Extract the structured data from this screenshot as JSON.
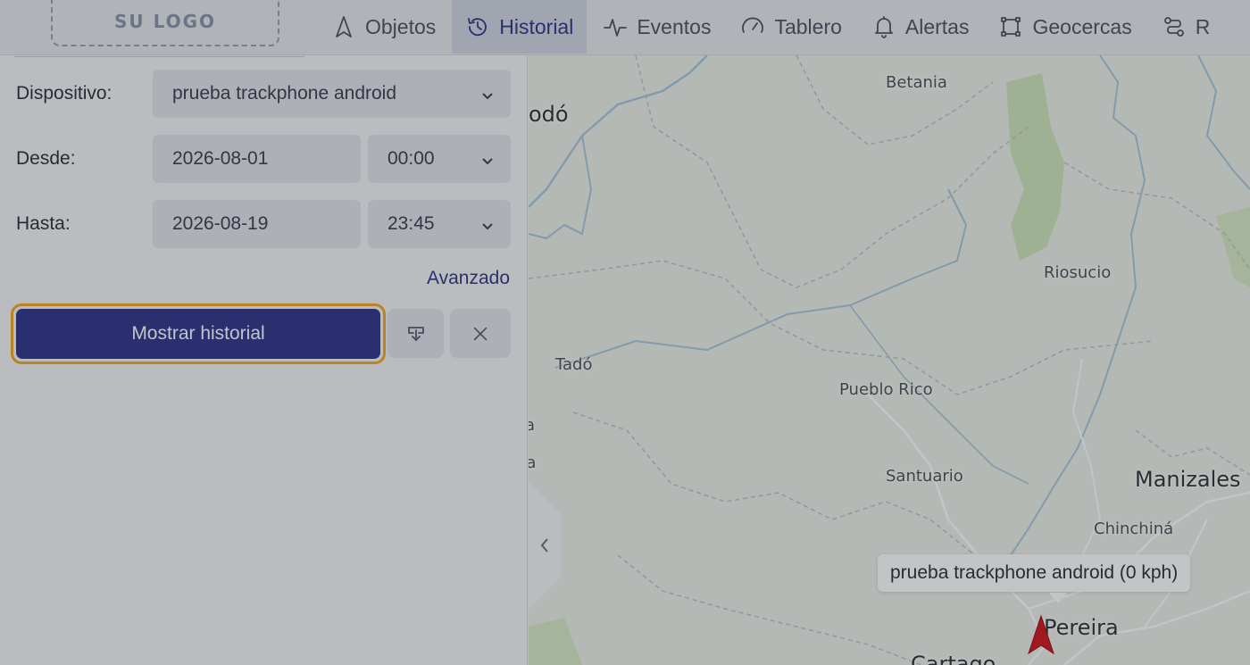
{
  "header": {
    "logo_text": "SU LOGO",
    "tabs": [
      {
        "label": "Objetos",
        "icon": "navigation-arrow-icon"
      },
      {
        "label": "Historial",
        "icon": "history-icon",
        "active": true
      },
      {
        "label": "Eventos",
        "icon": "activity-icon"
      },
      {
        "label": "Tablero",
        "icon": "gauge-icon"
      },
      {
        "label": "Alertas",
        "icon": "bell-icon"
      },
      {
        "label": "Geocercas",
        "icon": "geofence-icon"
      },
      {
        "label": "R",
        "icon": "route-icon"
      }
    ]
  },
  "history_form": {
    "device_label": "Dispositivo:",
    "device_value": "prueba trackphone android",
    "from_label": "Desde:",
    "from_date": "2026-08-01",
    "from_time": "00:00",
    "to_label": "Hasta:",
    "to_date": "2026-08-19",
    "to_time": "23:45",
    "advanced_link": "Avanzado",
    "show_button": "Mostrar historial",
    "download_icon": "download-icon",
    "clear_icon": "close-icon"
  },
  "map": {
    "places": [
      {
        "name": "Betania",
        "size": "sm"
      },
      {
        "name": "odó",
        "size": "lg"
      },
      {
        "name": "Riosucio",
        "size": "sm"
      },
      {
        "name": "Tadó",
        "size": "sm"
      },
      {
        "name": "Pueblo Rico",
        "size": "sm"
      },
      {
        "name": "Santuario",
        "size": "sm"
      },
      {
        "name": "Manizales",
        "size": "lg"
      },
      {
        "name": "Chinchiná",
        "size": "sm"
      },
      {
        "name": "Pereira",
        "size": "lg"
      },
      {
        "name": "Cartago",
        "size": "lg"
      },
      {
        "name": "a",
        "size": "sm"
      },
      {
        "name": "ra",
        "size": "sm"
      }
    ],
    "marker_label": "prueba trackphone android (0 kph)",
    "marker_color": "#d0151b",
    "collapse_icon": "chevron-left-icon"
  },
  "colors": {
    "accent": "#2f3589",
    "focus_ring": "#f5a623"
  }
}
